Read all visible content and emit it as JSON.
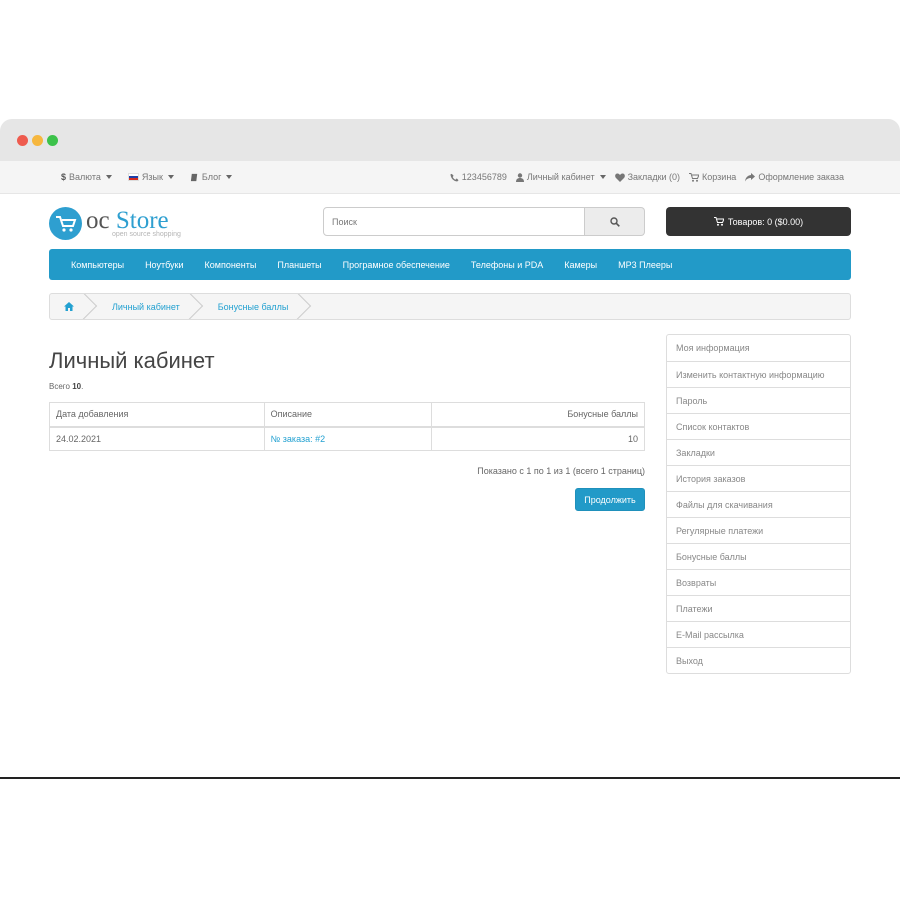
{
  "topbar": {
    "currency": "Валюта",
    "currency_symbol": "$",
    "language": "Язык",
    "blog": "Блог",
    "phone": "123456789",
    "account": "Личный кабинет",
    "wishlist": "Закладки (0)",
    "cart": "Корзина",
    "checkout": "Оформление заказа"
  },
  "logo": {
    "oc": "oc",
    "store": "Store",
    "sub": "open source shopping"
  },
  "search": {
    "placeholder": "Поиск"
  },
  "cart_button": "Товаров: 0 ($0.00)",
  "menu": [
    "Компьютеры",
    "Ноутбуки",
    "Компоненты",
    "Планшеты",
    "Програмное обеспечение",
    "Телефоны и PDA",
    "Камеры",
    "MP3 Плееры"
  ],
  "breadcrumb": [
    "Личный кабинет",
    "Бонусные баллы"
  ],
  "page": {
    "title": "Личный кабинет",
    "total_label": "Всего",
    "total_value": "10",
    "total_suffix": "."
  },
  "table": {
    "headers": [
      "Дата добавления",
      "Описание",
      "Бонусные баллы"
    ],
    "rows": [
      {
        "date": "24.02.2021",
        "description": "№ заказа: #2",
        "points": "10"
      }
    ]
  },
  "pagination_text": "Показано с 1 по 1 из 1 (всего 1 страниц)",
  "continue_button": "Продолжить",
  "sidebar": [
    "Моя информация",
    "Изменить контактную информацию",
    "Пароль",
    "Список контактов",
    "Закладки",
    "История заказов",
    "Файлы для скачивания",
    "Регулярные платежи",
    "Бонусные баллы",
    "Возвраты",
    "Платежи",
    "E-Mail рассылка",
    "Выход"
  ],
  "colors": {
    "accent": "#229ac8",
    "link": "#23a1d1",
    "dark_button": "#333333"
  }
}
